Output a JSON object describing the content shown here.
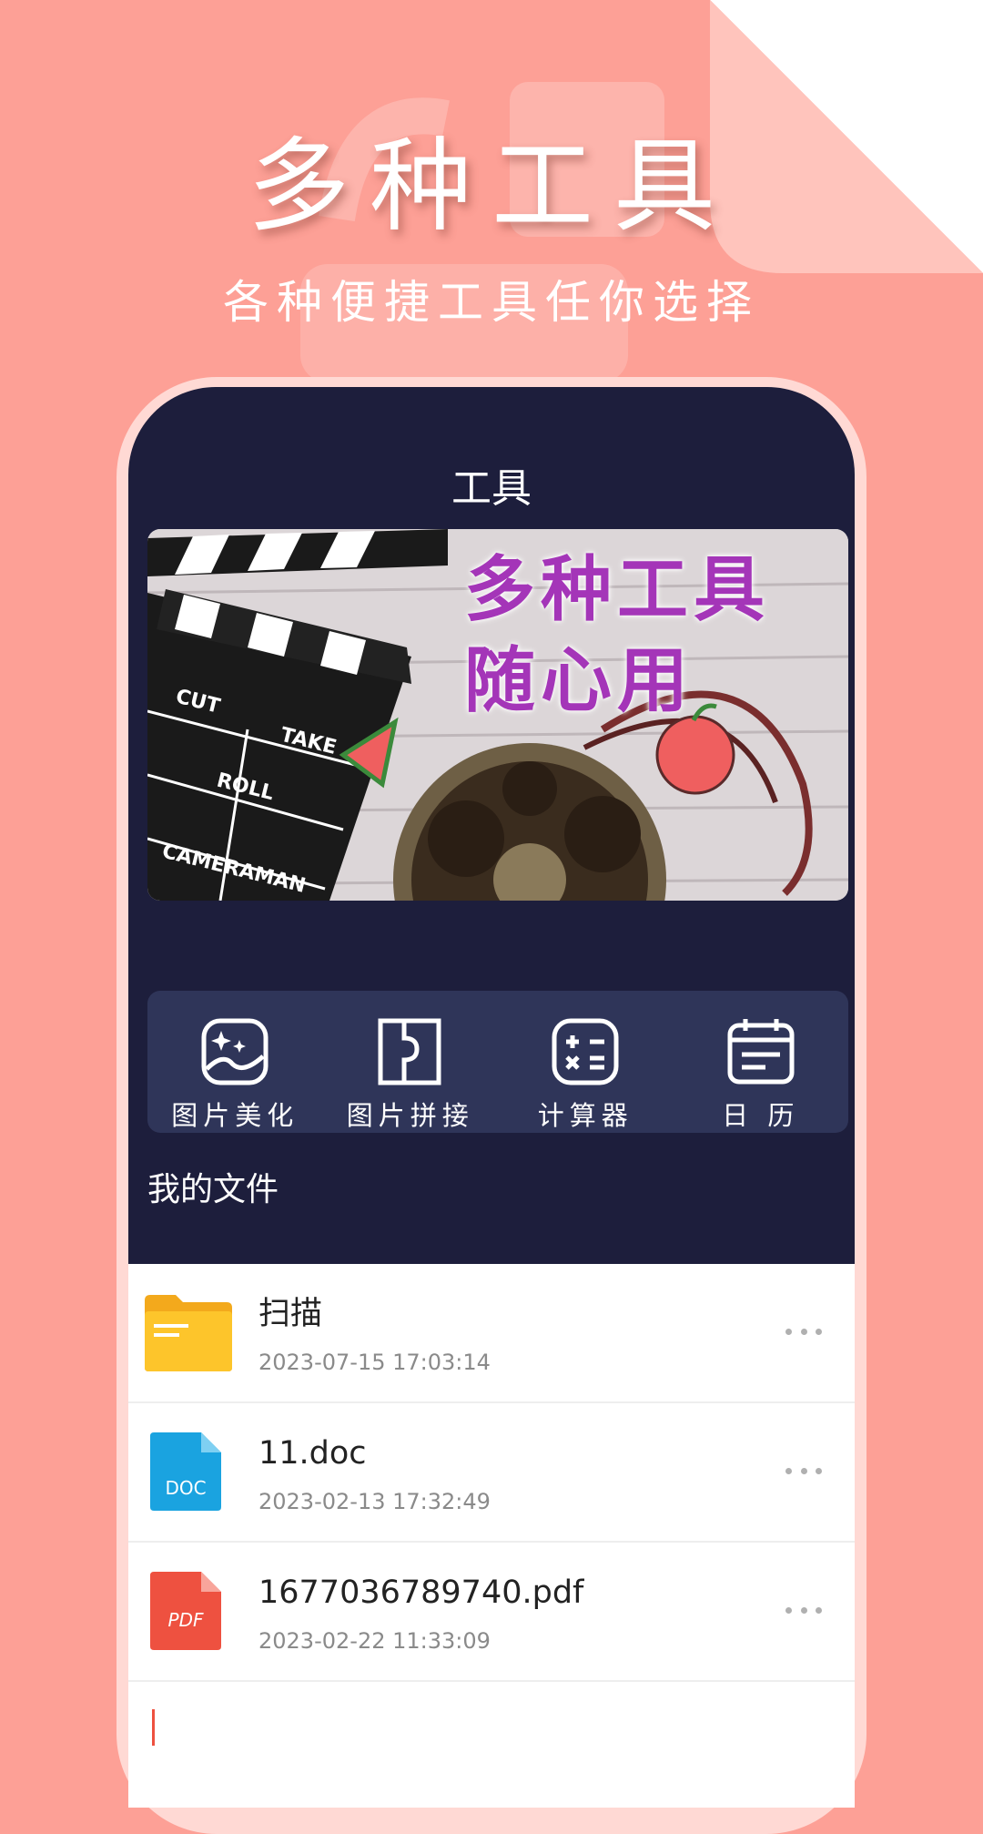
{
  "promo": {
    "title": "多种工具",
    "subtitle": "各种便捷工具任你选择"
  },
  "app": {
    "title": "工具"
  },
  "banner": {
    "line1": "多种工具",
    "line2": "随心用",
    "clapper_words": [
      "CUT",
      "TAKE",
      "ROLL",
      "CAMERAMAN"
    ]
  },
  "tools": [
    {
      "label": "图片美化",
      "icon": "photo-beautify-icon"
    },
    {
      "label": "图片拼接",
      "icon": "photo-stitch-icon"
    },
    {
      "label": "计算器",
      "icon": "calculator-icon"
    },
    {
      "label": "日 历",
      "icon": "calendar-icon"
    }
  ],
  "files_section": {
    "title": "我的文件"
  },
  "files": [
    {
      "name": "扫描",
      "date": "2023-07-15 17:03:14",
      "icon": "folder-icon",
      "color": "#fdc52b"
    },
    {
      "name": "11.doc",
      "date": "2023-02-13 17:32:49",
      "icon": "doc-file-icon",
      "badge": "DOC",
      "color": "#1aa3e0"
    },
    {
      "name": "1677036789740.pdf",
      "date": "2023-02-22 11:33:09",
      "icon": "pdf-file-icon",
      "badge": "PDF",
      "color": "#ee5140"
    }
  ],
  "colors": {
    "background": "#fda096",
    "screen": "#1d1e3c",
    "tool_panel": "#2f3559",
    "banner_text": "#a435b8"
  }
}
